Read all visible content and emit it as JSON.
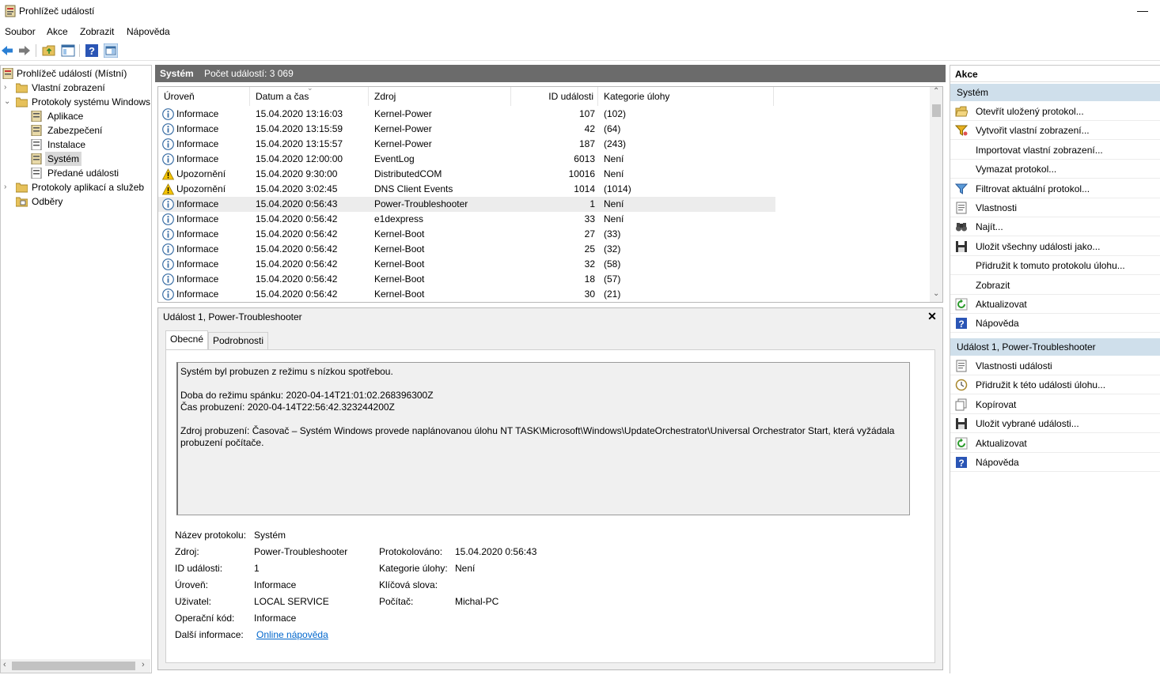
{
  "window": {
    "title": "Prohlížeč událostí",
    "minimize": "—"
  },
  "menu": [
    "Soubor",
    "Akce",
    "Zobrazit",
    "Nápověda"
  ],
  "tree": {
    "root": "Prohlížeč událostí (Místní)",
    "custom_views": "Vlastní zobrazení",
    "windows_logs": "Protokoly systému Windows",
    "app_logs": "Aplikace",
    "security": "Zabezpečení",
    "setup": "Instalace",
    "system": "Systém",
    "forwarded": "Předané události",
    "apps_services": "Protokoly aplikací a služeb",
    "subscriptions": "Odběry"
  },
  "center": {
    "log_name": "Systém",
    "count_label": "Počet událostí: 3 069",
    "columns": [
      "Úroveň",
      "Datum a čas",
      "Zdroj",
      "ID události",
      "Kategorie úlohy"
    ],
    "rows": [
      {
        "level": "Informace",
        "type": "info",
        "date": "15.04.2020 13:16:03",
        "source": "Kernel-Power",
        "id": "107",
        "cat": "(102)"
      },
      {
        "level": "Informace",
        "type": "info",
        "date": "15.04.2020 13:15:59",
        "source": "Kernel-Power",
        "id": "42",
        "cat": "(64)"
      },
      {
        "level": "Informace",
        "type": "info",
        "date": "15.04.2020 13:15:57",
        "source": "Kernel-Power",
        "id": "187",
        "cat": "(243)"
      },
      {
        "level": "Informace",
        "type": "info",
        "date": "15.04.2020 12:00:00",
        "source": "EventLog",
        "id": "6013",
        "cat": "Není"
      },
      {
        "level": "Upozornění",
        "type": "warn",
        "date": "15.04.2020 9:30:00",
        "source": "DistributedCOM",
        "id": "10016",
        "cat": "Není"
      },
      {
        "level": "Upozornění",
        "type": "warn",
        "date": "15.04.2020 3:02:45",
        "source": "DNS Client Events",
        "id": "1014",
        "cat": "(1014)"
      },
      {
        "level": "Informace",
        "type": "info",
        "date": "15.04.2020 0:56:43",
        "source": "Power-Troubleshooter",
        "id": "1",
        "cat": "Není",
        "selected": true
      },
      {
        "level": "Informace",
        "type": "info",
        "date": "15.04.2020 0:56:42",
        "source": "e1dexpress",
        "id": "33",
        "cat": "Není"
      },
      {
        "level": "Informace",
        "type": "info",
        "date": "15.04.2020 0:56:42",
        "source": "Kernel-Boot",
        "id": "27",
        "cat": "(33)"
      },
      {
        "level": "Informace",
        "type": "info",
        "date": "15.04.2020 0:56:42",
        "source": "Kernel-Boot",
        "id": "25",
        "cat": "(32)"
      },
      {
        "level": "Informace",
        "type": "info",
        "date": "15.04.2020 0:56:42",
        "source": "Kernel-Boot",
        "id": "32",
        "cat": "(58)"
      },
      {
        "level": "Informace",
        "type": "info",
        "date": "15.04.2020 0:56:42",
        "source": "Kernel-Boot",
        "id": "18",
        "cat": "(57)"
      },
      {
        "level": "Informace",
        "type": "info",
        "date": "15.04.2020 0:56:42",
        "source": "Kernel-Boot",
        "id": "30",
        "cat": "(21)"
      }
    ]
  },
  "detail": {
    "title": "Událost 1, Power-Troubleshooter",
    "close": "✕",
    "tab_general": "Obecné",
    "tab_details": "Podrobnosti",
    "description": "Systém byl probuzen z režimu s nízkou spotřebou.\n\nDoba do režimu spánku: 2020-04-14T21:01:02.268396300Z\nČas probuzení: 2020-04-14T22:56:42.323244200Z\n\nZdroj probuzení: Časovač – Systém Windows provede naplánovanou úlohu NT TASK\\Microsoft\\Windows\\UpdateOrchestrator\\Universal Orchestrator Start, která vyžádala\nprobuzení počítače.",
    "fields": {
      "log_name_lbl": "Název protokolu:",
      "log_name": "Systém",
      "source_lbl": "Zdroj:",
      "source": "Power-Troubleshooter",
      "logged_lbl": "Protokolováno:",
      "logged": "15.04.2020 0:56:43",
      "id_lbl": "ID události:",
      "id": "1",
      "cat_lbl": "Kategorie úlohy:",
      "cat": "Není",
      "level_lbl": "Úroveň:",
      "level": "Informace",
      "keywords_lbl": "Klíčová slova:",
      "user_lbl": "Uživatel:",
      "user": "LOCAL SERVICE",
      "computer_lbl": "Počítač:",
      "computer": "Michal-PC",
      "opcode_lbl": "Operační kód:",
      "opcode": "Informace",
      "more_lbl": "Další informace:",
      "more_link": "Online nápověda"
    }
  },
  "actions": {
    "header": "Akce",
    "section1": "Systém",
    "items1": [
      {
        "label": "Otevřít uložený protokol...",
        "icon": "folder-open-icon"
      },
      {
        "label": "Vytvořit vlastní zobrazení...",
        "icon": "filter-star-icon"
      },
      {
        "label": "Importovat vlastní zobrazení...",
        "icon": ""
      },
      {
        "label": "Vymazat protokol...",
        "icon": ""
      },
      {
        "label": "Filtrovat aktuální protokol...",
        "icon": "filter-icon"
      },
      {
        "label": "Vlastnosti",
        "icon": "properties-icon"
      },
      {
        "label": "Najít...",
        "icon": "binoculars-icon"
      },
      {
        "label": "Uložit všechny události jako...",
        "icon": "save-icon"
      },
      {
        "label": "Přidružit k tomuto protokolu úlohu...",
        "icon": ""
      },
      {
        "label": "Zobrazit",
        "icon": ""
      },
      {
        "label": "Aktualizovat",
        "icon": "refresh-icon"
      },
      {
        "label": "Nápověda",
        "icon": "help-icon"
      }
    ],
    "section2": "Událost 1, Power-Troubleshooter",
    "items2": [
      {
        "label": "Vlastnosti události",
        "icon": "properties-icon"
      },
      {
        "label": "Přidružit k této události úlohu...",
        "icon": "task-icon"
      },
      {
        "label": "Kopírovat",
        "icon": "copy-icon"
      },
      {
        "label": "Uložit vybrané události...",
        "icon": "save-icon"
      },
      {
        "label": "Aktualizovat",
        "icon": "refresh-icon"
      },
      {
        "label": "Nápověda",
        "icon": "help-icon"
      }
    ]
  }
}
